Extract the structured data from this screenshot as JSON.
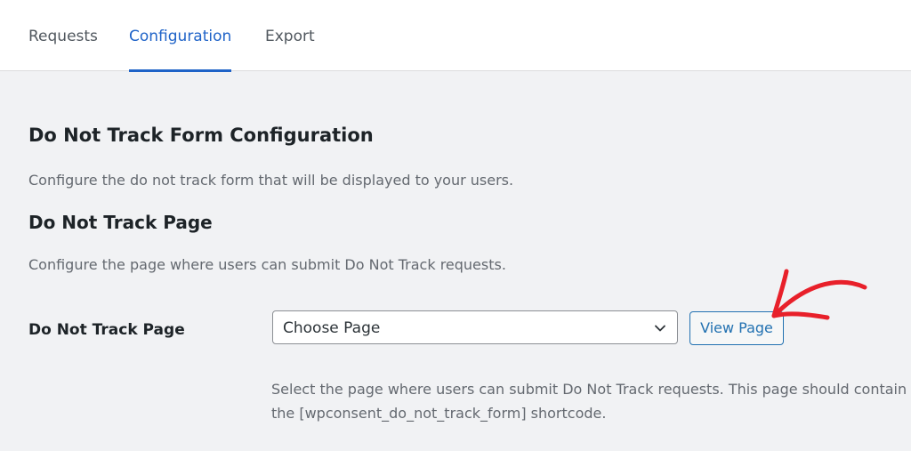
{
  "tabs": [
    {
      "label": "Requests",
      "active": false
    },
    {
      "label": "Configuration",
      "active": true
    },
    {
      "label": "Export",
      "active": false
    }
  ],
  "section": {
    "title": "Do Not Track Form Configuration",
    "description": "Configure the do not track form that will be displayed to your users."
  },
  "page_section": {
    "title": "Do Not Track Page",
    "description": "Configure the page where users can submit Do Not Track requests."
  },
  "field": {
    "label": "Do Not Track Page",
    "select_value": "Choose Page",
    "button_label": "View Page",
    "help_text": "Select the page where users can submit Do Not Track requests. This page should contain the [wpconsent_do_not_track_form] shortcode."
  },
  "colors": {
    "accent": "#1f63c8",
    "annotation_arrow": "#e8202a",
    "background": "#f1f2f4"
  },
  "icons": {
    "select_indicator": "chevron-down-icon",
    "annotation": "hand-drawn-arrow-icon"
  }
}
